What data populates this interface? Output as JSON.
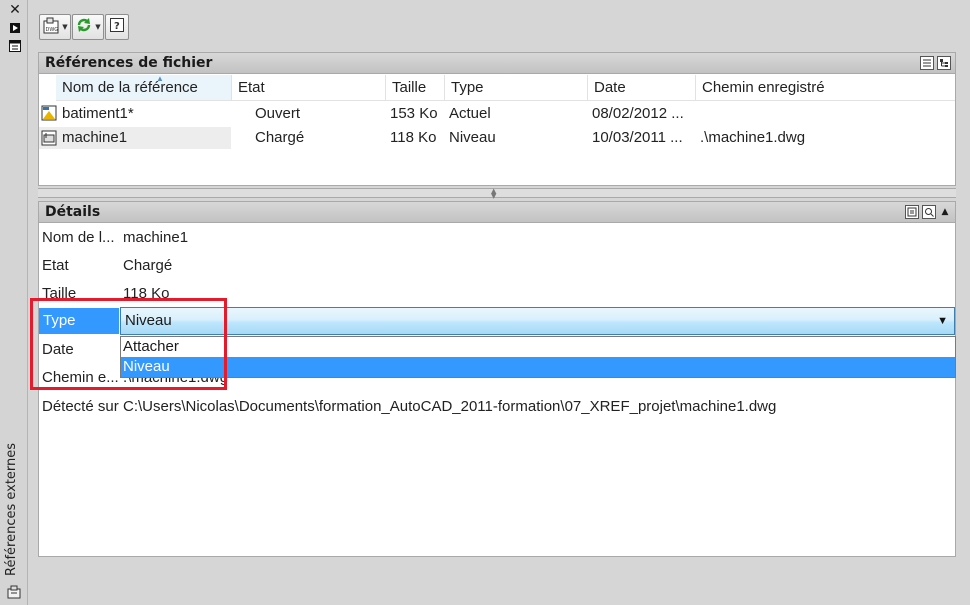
{
  "palette": {
    "title": "Références externes",
    "close_icon": "close-icon",
    "autohide_icon": "autohide-icon",
    "properties_icon": "properties-icon"
  },
  "toolbar": {
    "attach_icon": "attach-dwg-icon",
    "refresh_icon": "refresh-icon",
    "help_icon": "help-icon"
  },
  "file_refs": {
    "title": "Références de fichier",
    "columns": [
      "Nom de la référence",
      "Etat",
      "Taille",
      "Type",
      "Date",
      "Chemin enregistré"
    ],
    "rows": [
      {
        "name": "batiment1*",
        "status": "Ouvert",
        "size": "153 Ko",
        "type": "Actuel",
        "date": "08/02/2012 ...",
        "path": ""
      },
      {
        "name": "machine1",
        "status": "Chargé",
        "size": "118 Ko",
        "type": "Niveau",
        "date": "10/03/2011 ...",
        "path": ".\\machine1.dwg"
      }
    ]
  },
  "details": {
    "title": "Détails",
    "fields": [
      {
        "label": "Nom de l...",
        "value": "machine1"
      },
      {
        "label": "Etat",
        "value": "Chargé"
      },
      {
        "label": "Taille",
        "value": "118 Ko"
      },
      {
        "label": "Type",
        "value": "Niveau"
      },
      {
        "label": "Date",
        "value": ""
      },
      {
        "label": "Chemin e...",
        "value": ".\\machine1.dwg"
      },
      {
        "label": "Détecté sur",
        "value": "C:\\Users\\Nicolas\\Documents\\formation_AutoCAD_2011-formation\\07_XREF_projet\\machine1.dwg"
      }
    ],
    "type_options": [
      "Attacher",
      "Niveau"
    ],
    "type_selected": "Niveau"
  },
  "colors": {
    "highlight": "#3399ff",
    "annotation_box": "#e51a2a"
  }
}
